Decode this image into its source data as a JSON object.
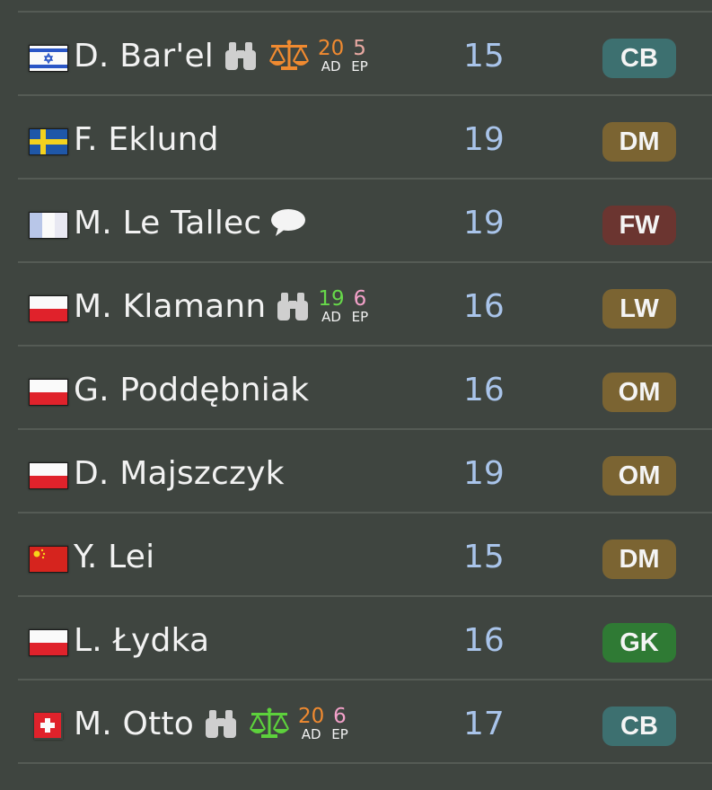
{
  "players": [
    {
      "name": "D. Bar'el",
      "age": "15",
      "position": "CB",
      "flag": "israel",
      "icons": [
        "binoculars-icon",
        "scales-icon"
      ],
      "scales_color": "#f08a30",
      "stats": [
        {
          "value": "20",
          "label": "AD",
          "color": "#f08a30"
        },
        {
          "value": "5",
          "label": "EP",
          "color": "#e8a9a2"
        }
      ]
    },
    {
      "name": "F. Eklund",
      "age": "19",
      "position": "DM",
      "flag": "sweden",
      "icons": [],
      "stats": []
    },
    {
      "name": "M. Le Tallec",
      "age": "19",
      "position": "FW",
      "flag": "france",
      "icons": [
        "speech-bubble-icon"
      ],
      "stats": []
    },
    {
      "name": "M. Klamann",
      "age": "16",
      "position": "LW",
      "flag": "poland",
      "icons": [
        "binoculars-icon"
      ],
      "stats": [
        {
          "value": "19",
          "label": "AD",
          "color": "#67d94a"
        },
        {
          "value": "6",
          "label": "EP",
          "color": "#f3a1c9"
        }
      ]
    },
    {
      "name": "G. Poddębniak",
      "age": "16",
      "position": "OM",
      "flag": "poland",
      "icons": [],
      "stats": []
    },
    {
      "name": "D. Majszczyk",
      "age": "19",
      "position": "OM",
      "flag": "poland",
      "icons": [],
      "stats": []
    },
    {
      "name": "Y. Lei",
      "age": "15",
      "position": "DM",
      "flag": "china",
      "icons": [],
      "stats": []
    },
    {
      "name": "L. Łydka",
      "age": "16",
      "position": "GK",
      "flag": "poland",
      "icons": [],
      "stats": []
    },
    {
      "name": "M. Otto",
      "age": "17",
      "position": "CB",
      "flag": "switzerland",
      "icons": [
        "binoculars-icon",
        "scales-icon"
      ],
      "scales_color": "#5dd13c",
      "stats": [
        {
          "value": "20",
          "label": "AD",
          "color": "#f08a30"
        },
        {
          "value": "6",
          "label": "EP",
          "color": "#f3a1c9"
        }
      ]
    }
  ],
  "position_colors": {
    "CB": "#3d7070",
    "DM": "#7b6432",
    "FW": "#6b3530",
    "LW": "#7b6432",
    "OM": "#7b6432",
    "GK": "#2f7a34"
  }
}
